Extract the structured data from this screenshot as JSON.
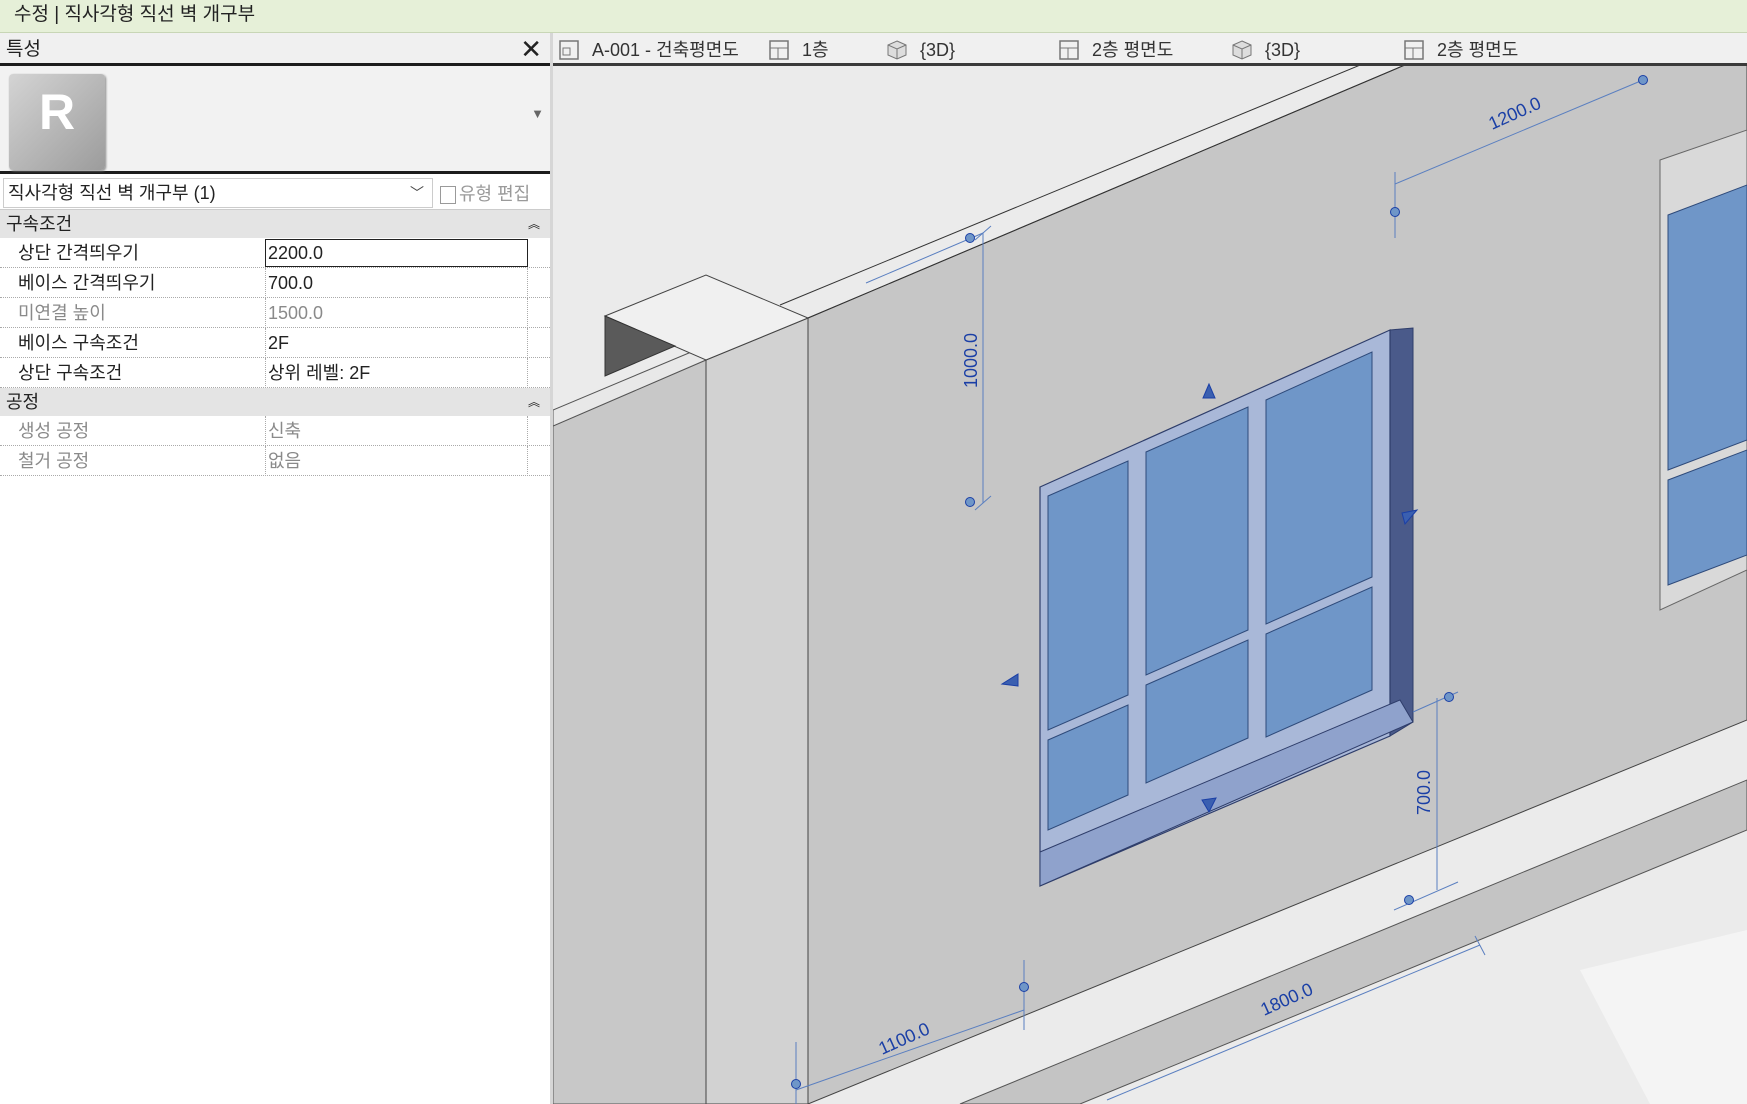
{
  "window": {
    "title": "수정 | 직사각형 직선 벽 개구부"
  },
  "properties_panel": {
    "title": "특성",
    "type_selector": {
      "value": "직사각형 직선 벽 개구부 (1)"
    },
    "edit_type_label": "유형 편집",
    "groups": [
      {
        "name": "구속조건",
        "rows": [
          {
            "label": "상단 간격띄우기",
            "value": "2200.0",
            "editing": true,
            "disabled": false
          },
          {
            "label": "베이스 간격띄우기",
            "value": "700.0",
            "editing": false,
            "disabled": false
          },
          {
            "label": "미연결 높이",
            "value": "1500.0",
            "editing": false,
            "disabled": true
          },
          {
            "label": "베이스 구속조건",
            "value": "2F",
            "editing": false,
            "disabled": false
          },
          {
            "label": "상단 구속조건",
            "value": "상위 레벨: 2F",
            "editing": false,
            "disabled": false
          }
        ]
      },
      {
        "name": "공정",
        "rows": [
          {
            "label": "생성 공정",
            "value": "신축",
            "editing": false,
            "disabled": true
          },
          {
            "label": "철거 공정",
            "value": "없음",
            "editing": false,
            "disabled": true
          }
        ]
      }
    ]
  },
  "view_tabs": [
    {
      "label": "A-001 - 건축평면도",
      "icon": "sheet-icon"
    },
    {
      "label": "1층",
      "icon": "floor-plan-icon"
    },
    {
      "label": "{3D}",
      "icon": "3d-view-icon"
    },
    {
      "label": "2층 평면도",
      "icon": "floor-plan-icon"
    },
    {
      "label": "{3D}",
      "icon": "3d-view-icon"
    },
    {
      "label": "2층 평면도",
      "icon": "floor-plan-icon"
    }
  ],
  "viewport": {
    "dimensions": {
      "top_offset": "1000.0",
      "width_top": "1200.0",
      "base_offset": "700.0",
      "width_bottom": "1800.0",
      "left_offset": "1100.0"
    },
    "colors": {
      "glass": "#6f96c8",
      "wall": "#c9c9c9",
      "dimension": "#1a3fa6",
      "highlight": "#5a7fc0"
    }
  }
}
